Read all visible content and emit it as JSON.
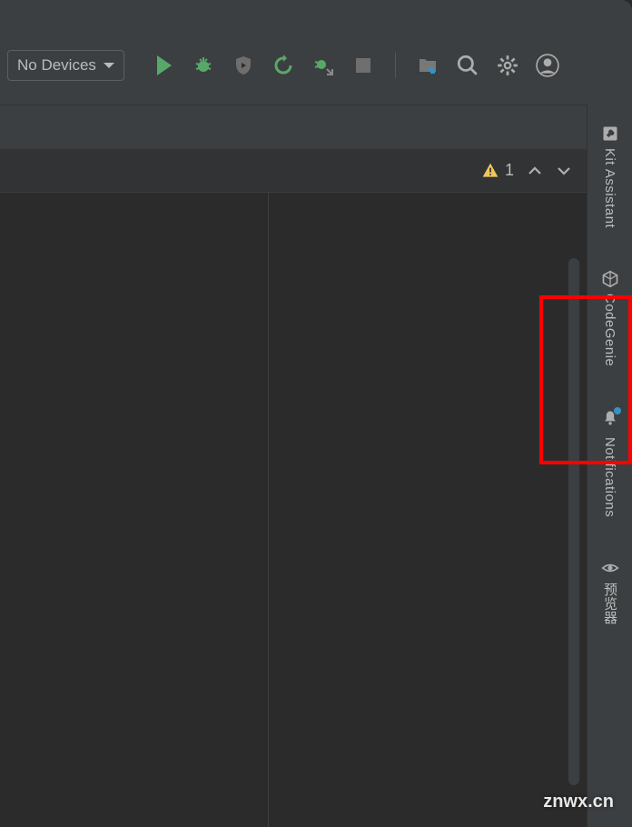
{
  "toolbar": {
    "device_label": "No Devices"
  },
  "editor": {
    "warning_count": "1"
  },
  "sidebar": {
    "items": [
      {
        "label": "Kit Assistant",
        "icon": "wrench-icon"
      },
      {
        "label": "CodeGenie",
        "icon": "cube-icon"
      },
      {
        "label": "Notifications",
        "icon": "bell-icon"
      },
      {
        "label": "预览器",
        "icon": "eye-icon"
      }
    ]
  },
  "watermark": "znwx.cn"
}
